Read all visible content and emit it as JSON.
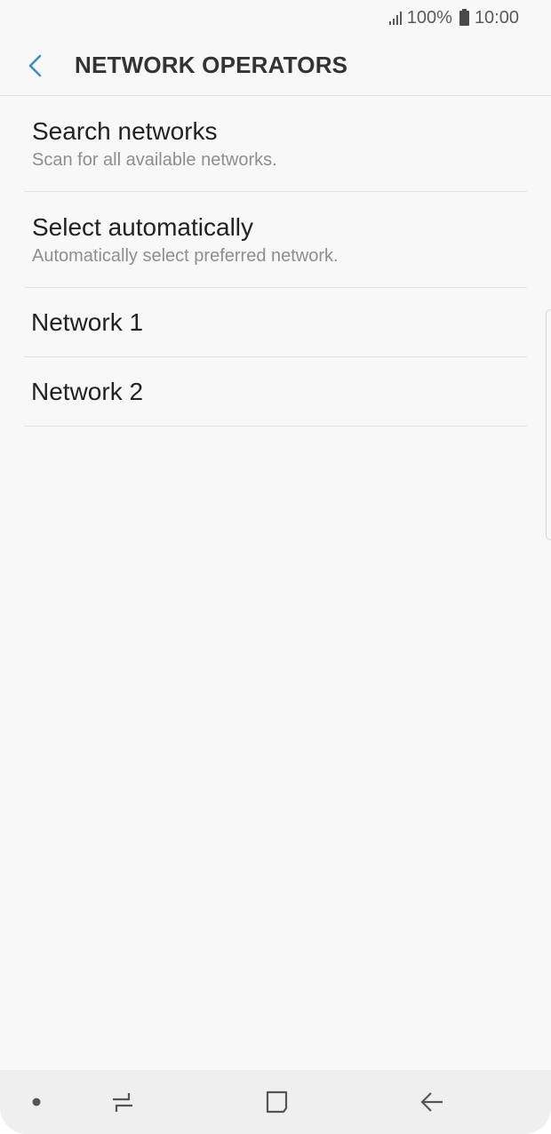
{
  "status_bar": {
    "battery": "100%",
    "time": "10:00",
    "icons": [
      "signal-icon",
      "battery-icon"
    ]
  },
  "app_bar": {
    "title": "NETWORK OPERATORS",
    "back_icon": "chevron-left-icon",
    "accent_color": "#3a8fc2"
  },
  "list": {
    "items": [
      {
        "title": "Search networks",
        "subtitle": "Scan for all available networks."
      },
      {
        "title": "Select automatically",
        "subtitle": "Automatically select preferred network."
      },
      {
        "title": "Network 1"
      },
      {
        "title": "Network 2"
      }
    ]
  },
  "nav_bar": {
    "buttons": [
      "dot-icon",
      "recent-apps-icon",
      "home-icon",
      "back-arrow-icon"
    ]
  }
}
